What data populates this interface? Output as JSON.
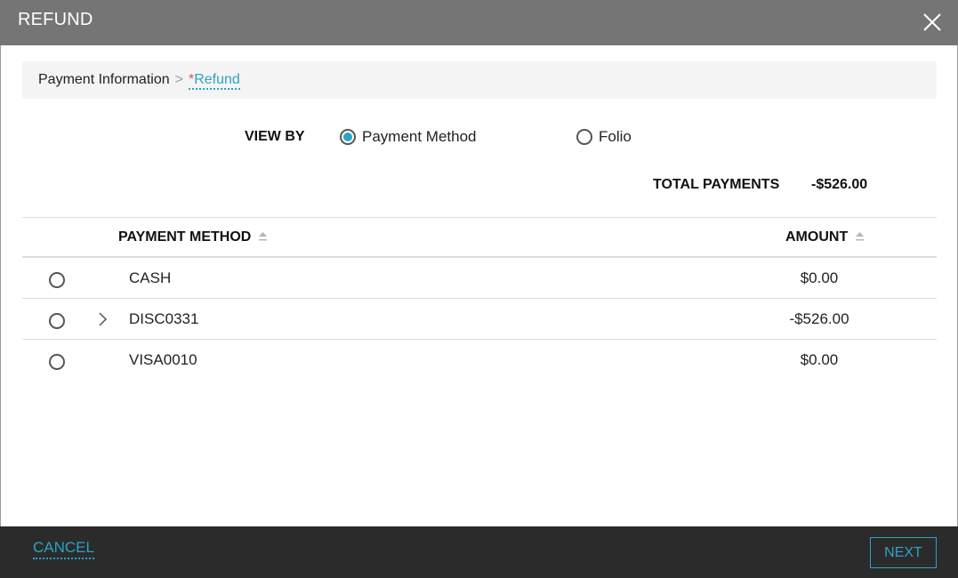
{
  "dialog": {
    "title": "REFUND",
    "close_icon": "close-icon"
  },
  "breadcrumb": {
    "parent": "Payment Information",
    "separator": ">",
    "required_marker": "*",
    "current": "Refund"
  },
  "view_by": {
    "label": "VIEW BY",
    "options": [
      {
        "label": "Payment Method",
        "selected": true
      },
      {
        "label": "Folio",
        "selected": false
      }
    ]
  },
  "totals": {
    "label": "TOTAL PAYMENTS",
    "value": "-$526.00"
  },
  "table": {
    "columns": [
      {
        "label": "PAYMENT METHOD",
        "sort_icon": "sort-icon"
      },
      {
        "label": "AMOUNT",
        "sort_icon": "sort-icon"
      }
    ],
    "rows": [
      {
        "method": "CASH",
        "amount": "$0.00",
        "expandable": false,
        "selected": false
      },
      {
        "method": "DISC0331",
        "amount": "-$526.00",
        "expandable": true,
        "selected": false
      },
      {
        "method": "VISA0010",
        "amount": "$0.00",
        "expandable": false,
        "selected": false
      }
    ]
  },
  "footer": {
    "cancel_label": "CANCEL",
    "next_label": "NEXT"
  },
  "colors": {
    "accent": "#2aa4c9",
    "title_bar": "#757575",
    "footer_bar": "#2b2b2b",
    "required": "#d9534f"
  }
}
